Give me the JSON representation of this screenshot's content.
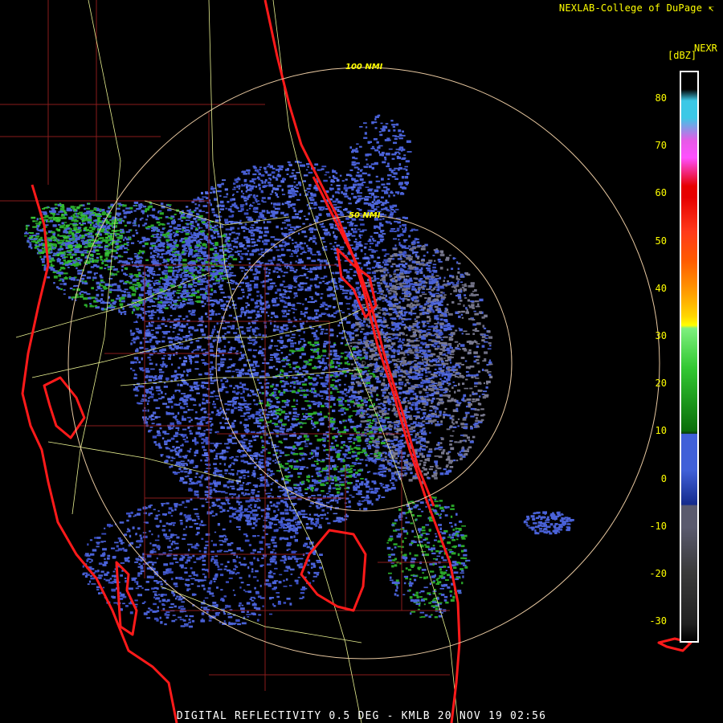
{
  "credit": "NEXLAB-College of DuPage",
  "product_code": "NEXR",
  "unit": "[dBZ]",
  "colorbar": {
    "ticks": [
      "80",
      "70",
      "60",
      "50",
      "40",
      "30",
      "20",
      "10",
      "0",
      "-10",
      "-20",
      "-30"
    ],
    "colors": {
      "dbz_80": "#3cc8e6",
      "dbz_70": "#e65ae6",
      "dbz_60": "#e60000",
      "dbz_50": "#ff5a00",
      "dbz_40": "#ffa000",
      "dbz_30": "#ffff00",
      "dbz_20": "#32c832",
      "dbz_10": "#0a6e0a",
      "dbz_0": "#4060d8",
      "dbz_m10": "#5a5a6e",
      "dbz_m20": "#3a3a3a",
      "dbz_m30": "#202020"
    }
  },
  "range_rings": [
    {
      "label": "100 NMI",
      "radius_nmi": 100
    },
    {
      "label": "50 NMI",
      "radius_nmi": 50
    }
  ],
  "footer": "DIGITAL REFLECTIVITY 0.5 DEG - KMLB 20 NOV 19 02:56",
  "colors": {
    "coastline": "#ff1a1a",
    "county_lines": "#8a1c1c",
    "roads": "#e8f090",
    "ring": "#e8c8a0",
    "echo_light": "#4a62d8",
    "echo_green": "#2aa82a",
    "echo_gray": "#6e6e82"
  }
}
